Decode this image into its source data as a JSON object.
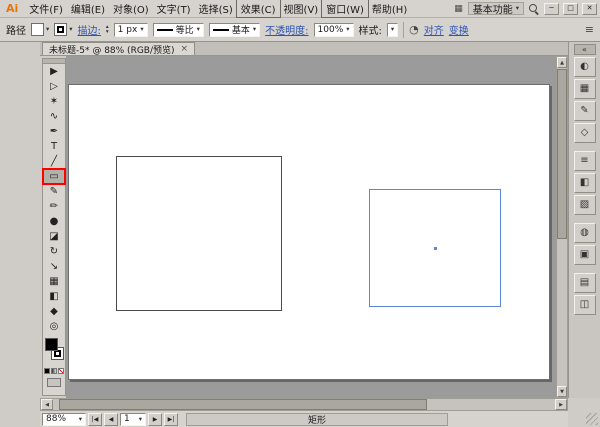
{
  "window": {
    "logo": "Ai",
    "menus": [
      {
        "label": "文件(F)",
        "boxed": false
      },
      {
        "label": "编辑(E)",
        "boxed": false
      },
      {
        "label": "对象(O)",
        "boxed": false
      },
      {
        "label": "文字(T)",
        "boxed": false
      },
      {
        "label": "选择(S)",
        "boxed": false
      },
      {
        "label": "效果(C)",
        "boxed": true
      },
      {
        "label": "视图(V)",
        "boxed": false
      },
      {
        "label": "窗口(W)",
        "boxed": true
      },
      {
        "label": "帮助(H)",
        "boxed": false
      }
    ],
    "workspace": "基本功能",
    "buttons": {
      "minimize": "─",
      "restore": "□",
      "close": "✕"
    }
  },
  "icons": {
    "caret_down": "▾",
    "caret_up": "▴",
    "arrow_up": "▲",
    "arrow_down": "▼",
    "arrow_left": "◀",
    "arrow_right": "▶",
    "arrange_documents": "▦",
    "recolor_artwork": "◔",
    "panel_menu": "≡",
    "collapse_dock": "«",
    "nav_first": "|◀",
    "nav_prev": "◀",
    "nav_next": "▶",
    "nav_last": "▶|",
    "tab_close": "×"
  },
  "control_bar": {
    "target_label": "路径",
    "stroke_link": "描边:",
    "stroke_weight": "1 px",
    "profile_value": "等比",
    "brush_value": "基本",
    "opacity_link": "不透明度:",
    "opacity_value": "100%",
    "style_label": "样式:",
    "align_link": "对齐",
    "transform_link": "变换"
  },
  "document": {
    "tab_title": "未标题-5* @ 88% (RGB/预览)"
  },
  "tools": [
    {
      "name": "selection",
      "glyph": "▶"
    },
    {
      "name": "direct-selection",
      "glyph": "▷"
    },
    {
      "name": "magic-wand",
      "glyph": "✶"
    },
    {
      "name": "lasso",
      "glyph": "∿"
    },
    {
      "name": "pen",
      "glyph": "✒"
    },
    {
      "name": "type",
      "glyph": "T"
    },
    {
      "name": "line-segment",
      "glyph": "╱"
    },
    {
      "name": "rectangle",
      "glyph": "▭",
      "selected": true
    },
    {
      "name": "paintbrush",
      "glyph": "✎"
    },
    {
      "name": "pencil",
      "glyph": "✏"
    },
    {
      "name": "blob-brush",
      "glyph": "●"
    },
    {
      "name": "eraser",
      "glyph": "◪"
    },
    {
      "name": "rotate",
      "glyph": "↻"
    },
    {
      "name": "scale",
      "glyph": "↘"
    },
    {
      "name": "mesh",
      "glyph": "▦"
    },
    {
      "name": "gradient",
      "glyph": "◧"
    },
    {
      "name": "eyedropper",
      "glyph": "◆"
    },
    {
      "name": "zoom",
      "glyph": "◎"
    }
  ],
  "panels": [
    {
      "name": "color",
      "glyph": "◐"
    },
    {
      "name": "swatches",
      "glyph": "▦"
    },
    {
      "name": "brushes",
      "glyph": "✎"
    },
    {
      "name": "symbols",
      "glyph": "◇"
    },
    {
      "name": "stroke",
      "glyph": "≡"
    },
    {
      "name": "gradient",
      "glyph": "◧"
    },
    {
      "name": "transparency",
      "glyph": "▨"
    },
    {
      "name": "appearance",
      "glyph": "◍"
    },
    {
      "name": "graphic-styles",
      "glyph": "▣"
    },
    {
      "name": "layers",
      "glyph": "▤"
    },
    {
      "name": "artboards",
      "glyph": "◫"
    }
  ],
  "status_bar": {
    "zoom": "88%",
    "artboard_number": "1",
    "status_text": "矩形"
  },
  "colors": {
    "selection_blue": "#5b87d5",
    "highlight_red": "#ff0000",
    "link_blue": "#2b54b4",
    "logo_orange": "#e8750a"
  }
}
